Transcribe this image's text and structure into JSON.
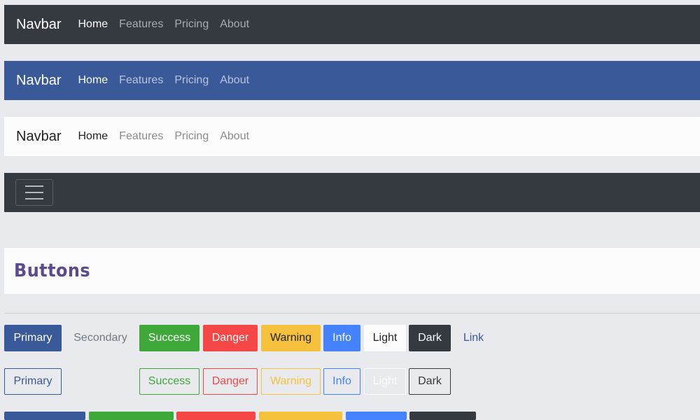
{
  "navbars": [
    {
      "brand": "Navbar",
      "links": [
        "Home",
        "Features",
        "Pricing",
        "About"
      ]
    },
    {
      "brand": "Navbar",
      "links": [
        "Home",
        "Features",
        "Pricing",
        "About"
      ]
    },
    {
      "brand": "Navbar",
      "links": [
        "Home",
        "Features",
        "Pricing",
        "About"
      ]
    }
  ],
  "toggler": {
    "icon": "hamburger-menu-icon"
  },
  "section": {
    "title": "Buttons"
  },
  "buttons": {
    "solid": [
      "Primary",
      "Secondary",
      "Success",
      "Danger",
      "Warning",
      "Info",
      "Light",
      "Dark",
      "Link"
    ],
    "outline": [
      "Primary",
      "Success",
      "Danger",
      "Warning",
      "Info",
      "Light",
      "Dark"
    ]
  },
  "colors": {
    "primary": "#3a5999",
    "success": "#3ea838",
    "danger": "#f44746",
    "warning": "#f6c23d",
    "info": "#4582ff",
    "light": "#fcfcfc",
    "dark": "#343a40",
    "page_background": "#e9eaee"
  }
}
